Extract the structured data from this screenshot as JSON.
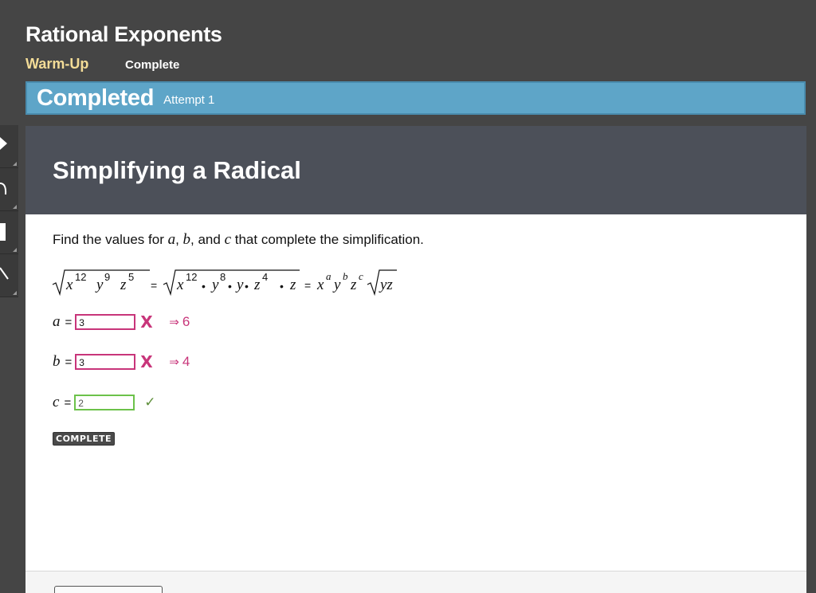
{
  "header": {
    "title": "Rational Exponents",
    "breadcrumb": [
      "Warm-Up",
      "Complete"
    ]
  },
  "status_bar": {
    "status": "Completed",
    "attempt": "Attempt 1"
  },
  "tools": [
    "pointer-tool",
    "curve-tool",
    "rectangle-tool",
    "line-tool"
  ],
  "activity": {
    "title": "Simplifying a Radical",
    "instruction": {
      "prefix": "Find the values for ",
      "var_a": "a",
      "sep1": ", ",
      "var_b": "b",
      "sep2": ", and ",
      "var_c": "c",
      "suffix": " that complete the simplification."
    },
    "equation": {
      "lhs_base1": "x",
      "lhs_exp1": "12",
      "lhs_base2": "y",
      "lhs_exp2": "9",
      "lhs_base3": "z",
      "lhs_exp3": "5",
      "eq1": "=",
      "mid_base1": "x",
      "mid_exp1": "12",
      "mid_base2": "y",
      "mid_exp2": "8",
      "mid_y": "y",
      "mid_base3": "z",
      "mid_exp3": "4",
      "mid_z": "z",
      "dot": "•",
      "eq2": "=",
      "rhs_x": "x",
      "rhs_a": "a",
      "rhs_y": "y",
      "rhs_b": "b",
      "rhs_z": "z",
      "rhs_c": "c",
      "rhs_radicand": "yz"
    },
    "answers": [
      {
        "variable": "a",
        "equals": "=",
        "value": "3",
        "result": "incorrect",
        "mark": "X",
        "arrow": "⇒",
        "correct": "6"
      },
      {
        "variable": "b",
        "equals": "=",
        "value": "3",
        "result": "incorrect",
        "mark": "X",
        "arrow": "⇒",
        "correct": "4"
      },
      {
        "variable": "c",
        "equals": "=",
        "value": "2",
        "result": "correct",
        "mark": "✓"
      }
    ],
    "complete_label": "COMPLETE"
  },
  "colors": {
    "background": "#454545",
    "status_bar": "#5ea5c8",
    "card_header": "#4c5059",
    "breadcrumb_active": "#f3dc97",
    "incorrect": "#c8357a",
    "correct": "#6cc24a"
  }
}
